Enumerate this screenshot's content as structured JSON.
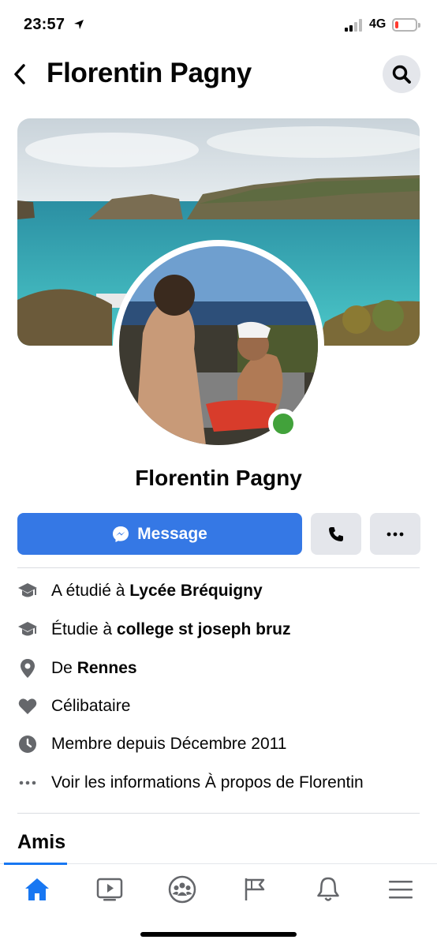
{
  "status_bar": {
    "time": "23:57",
    "network": "4G",
    "battery_level": 0.15,
    "icons": [
      "location-arrow-icon",
      "signal-icon",
      "battery-icon"
    ]
  },
  "header": {
    "title": "Florentin Pagny",
    "back_icon": "chevron-left-icon",
    "search_icon": "search-icon"
  },
  "profile": {
    "name": "Florentin Pagny",
    "online": true,
    "online_color": "#42a23b"
  },
  "actions": {
    "message_label": "Message",
    "message_icon": "messenger-icon",
    "call_icon": "phone-icon",
    "more_icon": "ellipsis-icon",
    "accent": "#3578e5"
  },
  "info": [
    {
      "icon": "graduation-cap-icon",
      "prefix": "A étudié à ",
      "bold": "Lycée Bréquigny"
    },
    {
      "icon": "graduation-cap-icon",
      "prefix": "Étudie à ",
      "bold": "college st joseph bruz"
    },
    {
      "icon": "map-pin-icon",
      "prefix": "De ",
      "bold": "Rennes"
    },
    {
      "icon": "heart-icon",
      "prefix": "Célibataire",
      "bold": ""
    },
    {
      "icon": "clock-icon",
      "prefix": "Membre depuis Décembre 2011",
      "bold": ""
    },
    {
      "icon": "ellipsis-icon",
      "prefix": "Voir les informations À propos de Florentin",
      "bold": ""
    }
  ],
  "friends": {
    "title": "Amis"
  },
  "tab_bar": {
    "tabs": [
      "home-icon",
      "video-icon",
      "groups-icon",
      "pages-flag-icon",
      "notifications-bell-icon",
      "menu-icon"
    ],
    "active": "home-icon",
    "active_color": "#1877f2"
  }
}
